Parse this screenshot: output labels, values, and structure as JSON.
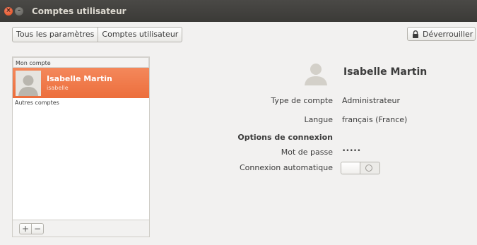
{
  "window": {
    "title": "Comptes utilisateur"
  },
  "toolbar": {
    "breadcrumb": [
      "Tous les paramètres",
      "Comptes utilisateur"
    ],
    "unlock_label": "Déverrouiller"
  },
  "sidebar": {
    "my_account_header": "Mon compte",
    "selected_user": {
      "name": "Isabelle Martin",
      "login": "isabelle"
    },
    "other_accounts_header": "Autres comptes",
    "add_label": "+",
    "remove_label": "−"
  },
  "details": {
    "name": "Isabelle Martin",
    "account_type_label": "Type de compte",
    "account_type_value": "Administrateur",
    "language_label": "Langue",
    "language_value": "français (France)",
    "login_options_header": "Options de connexion",
    "password_label": "Mot de passe",
    "password_value": "•••••",
    "autologin_label": "Connexion automatique",
    "autologin_enabled": false
  },
  "colors": {
    "selection": "#ec6e3c",
    "titlebar": "#3b3a37",
    "close": "#df4a16"
  },
  "icons": [
    "close-icon",
    "minimize-icon",
    "lock-icon",
    "user-avatar-icon"
  ]
}
